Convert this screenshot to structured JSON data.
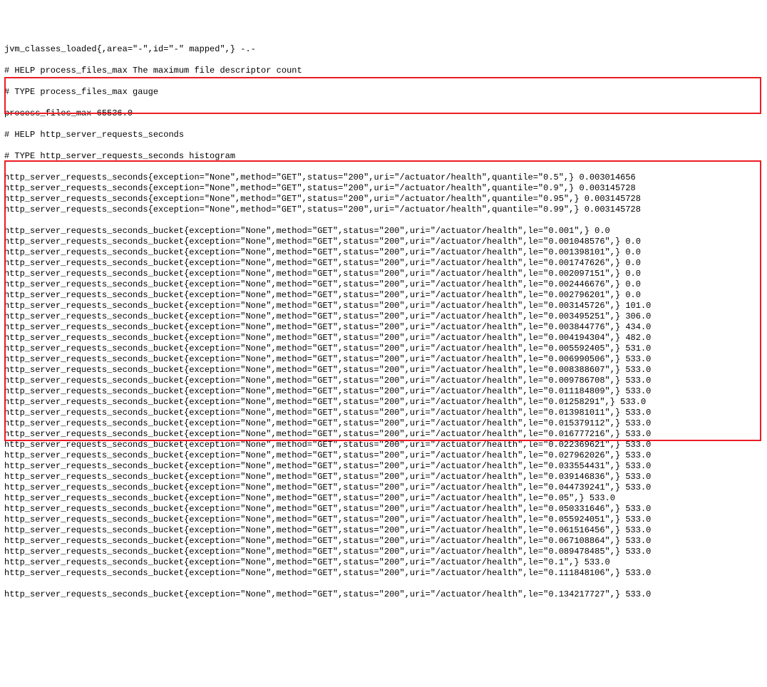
{
  "truncated_top": "jvm_classes_loaded{,area=\"-\",id=\"-\" mapped\",} -.-",
  "help_pfm": "# HELP process_files_max The maximum file descriptor count",
  "type_pfm": "# TYPE process_files_max gauge",
  "pfm_value": "process_files_max 65536.0",
  "help_http": "# HELP http_server_requests_seconds",
  "type_http": "# TYPE http_server_requests_seconds histogram",
  "quantiles": [
    {
      "q": "0.5",
      "v": "0.003014656"
    },
    {
      "q": "0.9",
      "v": "0.003145728"
    },
    {
      "q": "0.95",
      "v": "0.003145728"
    },
    {
      "q": "0.99",
      "v": "0.003145728"
    }
  ],
  "buckets": [
    {
      "le": "0.001",
      "v": "0.0"
    },
    {
      "le": "0.001048576",
      "v": "0.0"
    },
    {
      "le": "0.001398101",
      "v": "0.0"
    },
    {
      "le": "0.001747626",
      "v": "0.0"
    },
    {
      "le": "0.002097151",
      "v": "0.0"
    },
    {
      "le": "0.002446676",
      "v": "0.0"
    },
    {
      "le": "0.002796201",
      "v": "0.0"
    },
    {
      "le": "0.003145726",
      "v": "101.0"
    },
    {
      "le": "0.003495251",
      "v": "306.0"
    },
    {
      "le": "0.003844776",
      "v": "434.0"
    },
    {
      "le": "0.004194304",
      "v": "482.0"
    },
    {
      "le": "0.005592405",
      "v": "531.0"
    },
    {
      "le": "0.006990506",
      "v": "533.0"
    },
    {
      "le": "0.008388607",
      "v": "533.0"
    },
    {
      "le": "0.009786708",
      "v": "533.0"
    },
    {
      "le": "0.011184809",
      "v": "533.0"
    },
    {
      "le": "0.01258291",
      "v": "533.0"
    },
    {
      "le": "0.013981011",
      "v": "533.0"
    },
    {
      "le": "0.015379112",
      "v": "533.0"
    },
    {
      "le": "0.016777216",
      "v": "533.0"
    },
    {
      "le": "0.022369621",
      "v": "533.0"
    },
    {
      "le": "0.027962026",
      "v": "533.0"
    },
    {
      "le": "0.033554431",
      "v": "533.0"
    },
    {
      "le": "0.039146836",
      "v": "533.0"
    },
    {
      "le": "0.044739241",
      "v": "533.0"
    },
    {
      "le": "0.05",
      "v": "533.0"
    },
    {
      "le": "0.050331646",
      "v": "533.0"
    },
    {
      "le": "0.055924051",
      "v": "533.0"
    },
    {
      "le": "0.061516456",
      "v": "533.0"
    },
    {
      "le": "0.067108864",
      "v": "533.0"
    },
    {
      "le": "0.089478485",
      "v": "533.0"
    },
    {
      "le": "0.1",
      "v": "533.0"
    },
    {
      "le": "0.111848106",
      "v": "533.0"
    }
  ],
  "metric_prefix_q": "http_server_requests_seconds{exception=\"None\",method=\"GET\",status=\"200\",uri=\"/actuator/health\",quantile=\"",
  "metric_prefix_b": "http_server_requests_seconds_bucket{exception=\"None\",method=\"GET\",status=\"200\",uri=\"/actuator/health\",le=\"",
  "metric_suffix": "\",} ",
  "truncated_bottom": "http_server_requests_seconds_bucket{exception=\"None\",method=\"GET\",status=\"200\",uri=\"/actuator/health\",le=\"0.134217727\",} 533.0"
}
